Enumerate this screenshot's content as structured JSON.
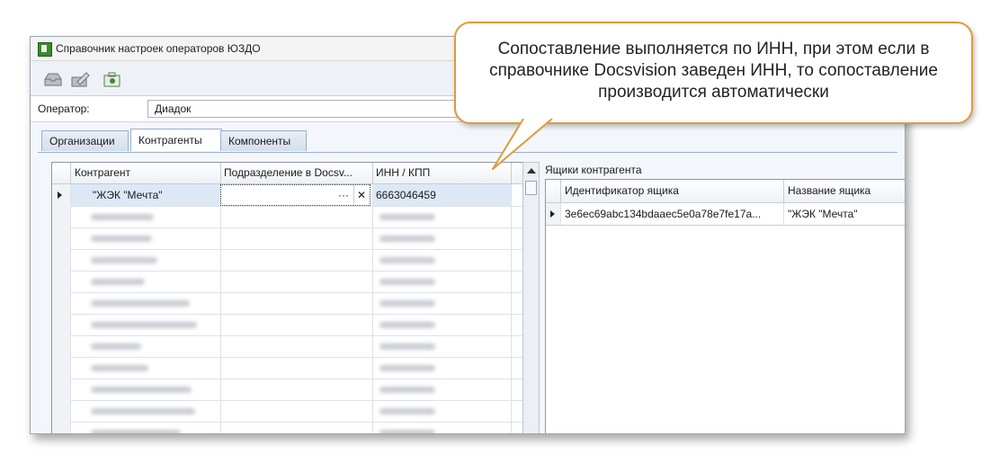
{
  "window": {
    "title": "Справочник настроек операторов ЮЗДО"
  },
  "toolbar": {
    "buttons": [
      {
        "icon": "inbox-icon"
      },
      {
        "icon": "edit-signature-icon"
      },
      {
        "icon": "settings-package-icon"
      }
    ]
  },
  "operator": {
    "label": "Оператор:",
    "value": "Диадок"
  },
  "tabs": {
    "org": "Организации",
    "contr": "Контрагенты",
    "comp": "Компоненты"
  },
  "contractors_grid": {
    "columns": {
      "contractor": "Контрагент",
      "subdivision": "Подразделение в Docsv...",
      "inn": "ИНН / КПП"
    },
    "selected_row": {
      "contractor": "\"ЖЭК \"Мечта\"",
      "subdivision": "",
      "inn": "6663046459",
      "ellipsis": "···",
      "clear": "✕"
    }
  },
  "mailboxes": {
    "label": "Ящики контрагента",
    "columns": {
      "id": "Идентификатор ящика",
      "name": "Название ящика"
    },
    "row": {
      "id": "3e6ec69abc134bdaaec5e0a78e7fe17a...",
      "name": "\"ЖЭК \"Мечта\""
    }
  },
  "callout": {
    "text": "Сопоставление выполняется по ИНН, при этом если в справочнике Docsvision заведен ИНН, то сопоставление производится автоматически"
  },
  "colors": {
    "callout_border": "#e09a3c",
    "selection": "#dde8f6"
  }
}
